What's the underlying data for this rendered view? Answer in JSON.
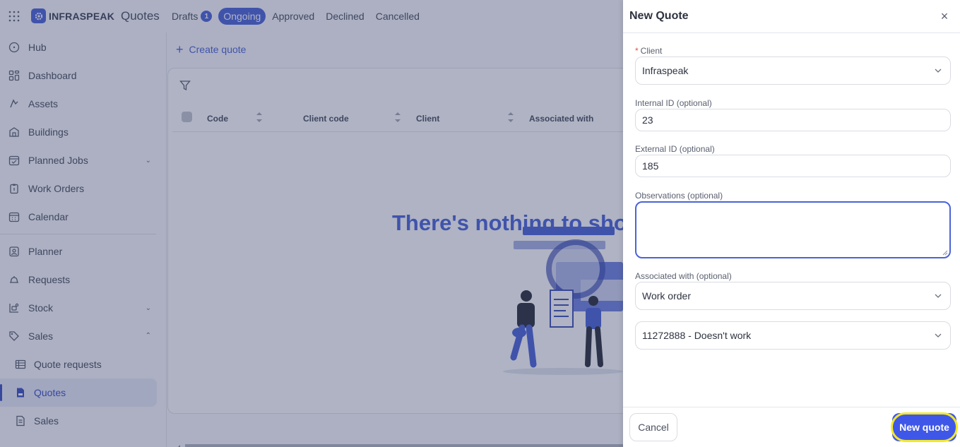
{
  "app": {
    "brand": "INFRASPEAK",
    "page_title": "Quotes"
  },
  "tabs": [
    {
      "label": "Drafts",
      "badge": "1"
    },
    {
      "label": "Ongoing"
    },
    {
      "label": "Approved"
    },
    {
      "label": "Declined"
    },
    {
      "label": "Cancelled"
    }
  ],
  "sidebar": {
    "items": [
      {
        "label": "Hub",
        "icon": "hub-icon"
      },
      {
        "label": "Dashboard",
        "icon": "dashboard-icon"
      },
      {
        "label": "Assets",
        "icon": "assets-icon"
      },
      {
        "label": "Buildings",
        "icon": "building-icon"
      },
      {
        "label": "Planned Jobs",
        "icon": "calendar-check-icon"
      },
      {
        "label": "Work Orders",
        "icon": "clipboard-icon"
      },
      {
        "label": "Calendar",
        "icon": "calendar-icon"
      },
      {
        "label": "Planner",
        "icon": "planner-icon"
      },
      {
        "label": "Requests",
        "icon": "bell-icon"
      },
      {
        "label": "Stock",
        "icon": "stock-icon"
      },
      {
        "label": "Sales",
        "icon": "tag-icon"
      },
      {
        "label": "Quote requests",
        "icon": "table-icon"
      },
      {
        "label": "Quotes",
        "icon": "quote-icon"
      },
      {
        "label": "Sales",
        "icon": "sales-doc-icon"
      }
    ]
  },
  "main": {
    "create_label": "Create quote",
    "columns": [
      "Code",
      "Client code",
      "Client",
      "Associated with"
    ],
    "empty_message": "There's nothing to show"
  },
  "drawer": {
    "title": "New Quote",
    "client": {
      "label": "Client",
      "value": "Infraspeak"
    },
    "internal_id": {
      "label": "Internal ID",
      "optional": "(optional)",
      "value": "23"
    },
    "external_id": {
      "label": "External ID",
      "optional": "(optional)",
      "value": "185"
    },
    "observations": {
      "label": "Observations",
      "optional": "(optional)",
      "value": ""
    },
    "associated_with": {
      "label": "Associated with",
      "optional": "(optional)",
      "value": "Work order"
    },
    "work_order": {
      "value": "11272888 - Doesn't work"
    },
    "cancel_label": "Cancel",
    "submit_label": "New quote"
  },
  "colors": {
    "accent": "#4d65d9",
    "primary_button": "#3f57e8",
    "highlight": "#f3e82a"
  }
}
